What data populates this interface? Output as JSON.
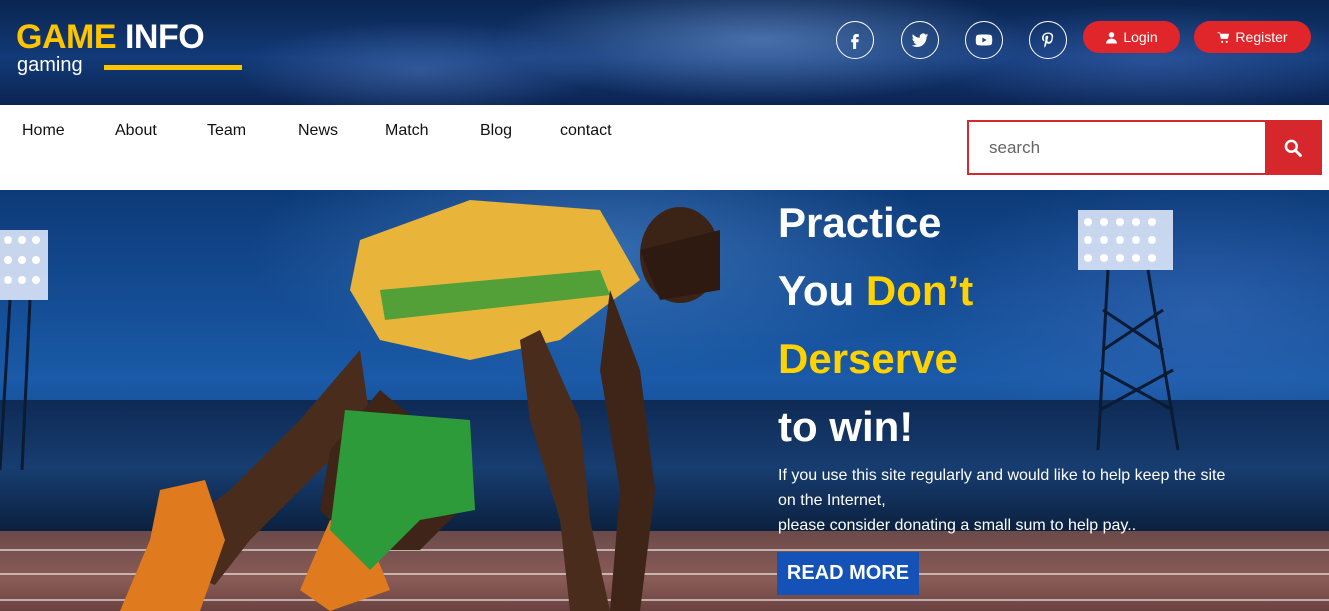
{
  "logo": {
    "word1": "GAME",
    "word2": "INFO",
    "subtitle": "gaming"
  },
  "social": [
    {
      "name": "facebook-icon"
    },
    {
      "name": "twitter-icon"
    },
    {
      "name": "youtube-icon"
    },
    {
      "name": "pinterest-icon"
    }
  ],
  "auth": {
    "login_label": "Login",
    "register_label": "Register",
    "accent_color": "#e0262b"
  },
  "nav": {
    "items": [
      "Home",
      "About",
      "Team",
      "News",
      "Match",
      "Blog",
      "contact"
    ]
  },
  "search": {
    "placeholder": "search",
    "value": ""
  },
  "hero": {
    "line1": "Practice",
    "line2_white": "You",
    "line2_yellow": "Don’t",
    "line3_yellow": "Derserve",
    "line4": "to win!",
    "paragraph_line1": "If you use this site regularly and would like to help keep the site",
    "paragraph_line2": "on the Internet,",
    "paragraph_line3": "please consider donating a small sum to help pay..",
    "button_label": "READ MORE",
    "highlight_color": "#ffd200",
    "button_color": "#1452b8"
  }
}
